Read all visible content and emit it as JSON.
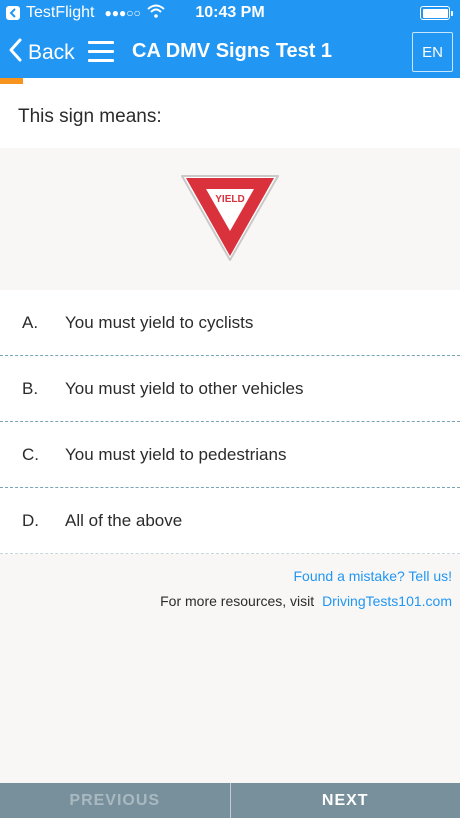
{
  "status_bar": {
    "carrier": "TestFlight",
    "signal": "●●●○○",
    "time": "10:43 PM"
  },
  "nav": {
    "back_label": "Back",
    "title": "CA DMV Signs Test 1",
    "language": "EN"
  },
  "progress": {
    "fraction": 0.05
  },
  "question": {
    "prompt": "This sign means:",
    "sign_text": "YIELD"
  },
  "answers": [
    {
      "letter": "A.",
      "text": "You must yield to cyclists"
    },
    {
      "letter": "B.",
      "text": "You must yield to other vehicles"
    },
    {
      "letter": "C.",
      "text": "You must yield to pedestrians"
    },
    {
      "letter": "D.",
      "text": "All of the above"
    }
  ],
  "footer_links": {
    "report": "Found a mistake? Tell us!",
    "resources_prefix": "For more resources, visit",
    "site": "DrivingTests101.com"
  },
  "bottom_nav": {
    "previous": "PREVIOUS",
    "next": "NEXT"
  },
  "colors": {
    "header": "#2196f3",
    "progress": "#f7941d",
    "bottom_bar": "#78909c",
    "sign_red": "#d9323c"
  }
}
